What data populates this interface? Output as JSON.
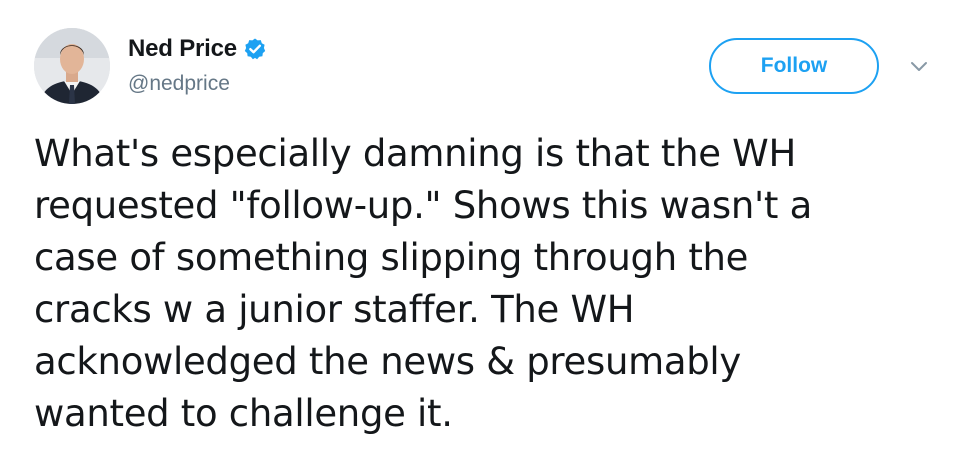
{
  "author": {
    "display_name": "Ned Price",
    "handle": "@nedprice",
    "verified": true,
    "avatar_icon": "profile-photo"
  },
  "actions": {
    "follow_label": "Follow",
    "menu_icon": "chevron-down-icon"
  },
  "tweet": {
    "text": "What's especially damning is that the WH\nrequested \"follow-up.\" Shows this wasn't a\ncase of something slipping through the\ncracks w a junior staffer. The WH\nacknowledged the news & presumably\nwanted to challenge it."
  },
  "colors": {
    "accent": "#1da1f2",
    "text": "#14171a",
    "secondary_text": "#657786"
  }
}
